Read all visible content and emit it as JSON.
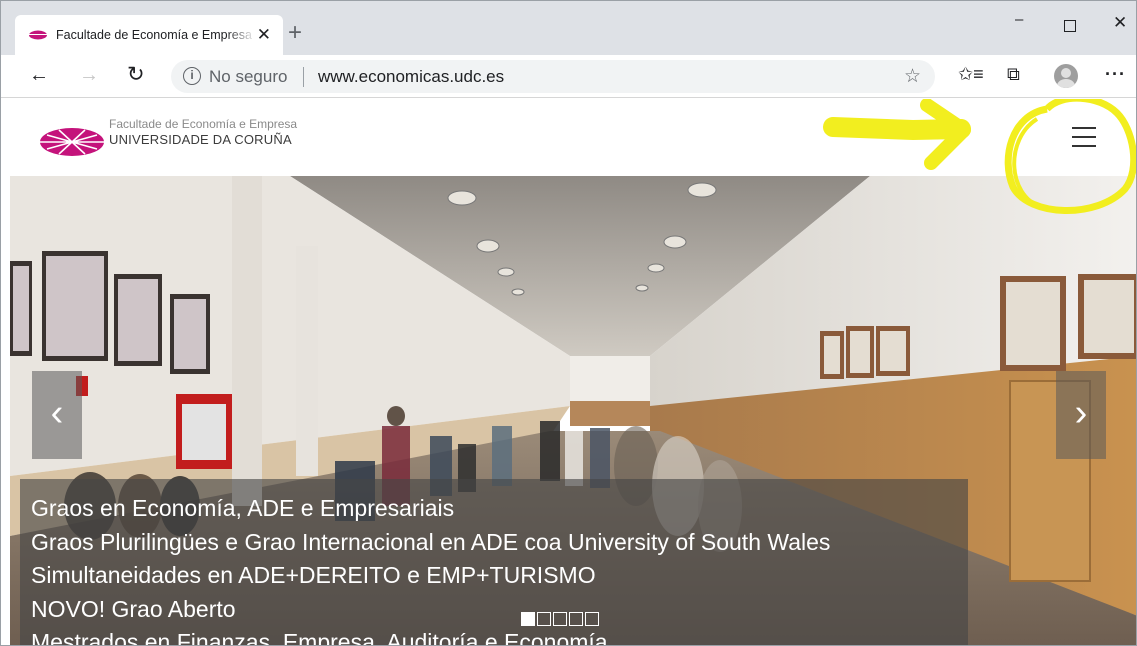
{
  "browser": {
    "tab": {
      "title": "Facultade de Economía e Empresa",
      "close_glyph": "✕",
      "favicon": "udc-logo-icon"
    },
    "new_tab_glyph": "+",
    "window_controls": {
      "minimize": "–",
      "close": "✕"
    },
    "nav": {
      "back": "←",
      "forward": "→",
      "reload": "↻"
    },
    "address": {
      "info_glyph": "i",
      "security": "No seguro",
      "url": "www.economicas.udc.es"
    },
    "toolbar": {
      "star": "☆",
      "favorites": "✩≡",
      "collections": "⧉",
      "more": "···"
    }
  },
  "site": {
    "logo_line1": "Facultade de Economía e Empresa",
    "logo_line2": "UNIVERSIDADE DA CORUÑA",
    "brand_color": "#c4137b"
  },
  "slider": {
    "prev": "‹",
    "next": "›",
    "caption_lines": [
      "Graos en Economía, ADE e Empresariais",
      "Graos Plurilingües e Grao Internacional en ADE coa University of South Wales",
      "Simultaneidades en ADE+DEREITO e EMP+TURISMO",
      "NOVO! Grao Aberto",
      "Mestrados en Finanzas, Empresa, Auditoría e Economía"
    ],
    "total_slides": 5,
    "active_slide": 1
  },
  "annotation": {
    "color": "#f2ee1f"
  }
}
